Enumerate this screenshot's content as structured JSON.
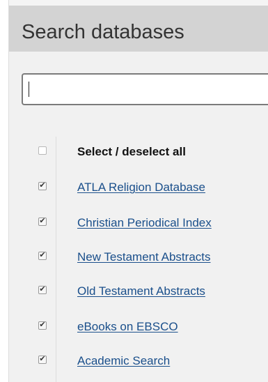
{
  "panel": {
    "title": "Search databases"
  },
  "search": {
    "value": "",
    "placeholder": ""
  },
  "select_all": {
    "label": "Select / deselect all",
    "checked": false
  },
  "databases": [
    {
      "label": "ATLA Religion Database",
      "checked": true
    },
    {
      "label": "Christian Periodical Index",
      "checked": true
    },
    {
      "label": "New Testament Abstracts",
      "checked": true
    },
    {
      "label": "Old Testament Abstracts",
      "checked": true
    },
    {
      "label": "eBooks on EBSCO",
      "checked": true
    },
    {
      "label": "Academic Search",
      "checked": true
    }
  ],
  "icons": {
    "checkmark": "checkmark-icon"
  },
  "colors": {
    "header_bg": "#d3d3d3",
    "panel_bg": "#f1f1f1",
    "link": "#1a4f8b",
    "title_text": "#333333"
  }
}
